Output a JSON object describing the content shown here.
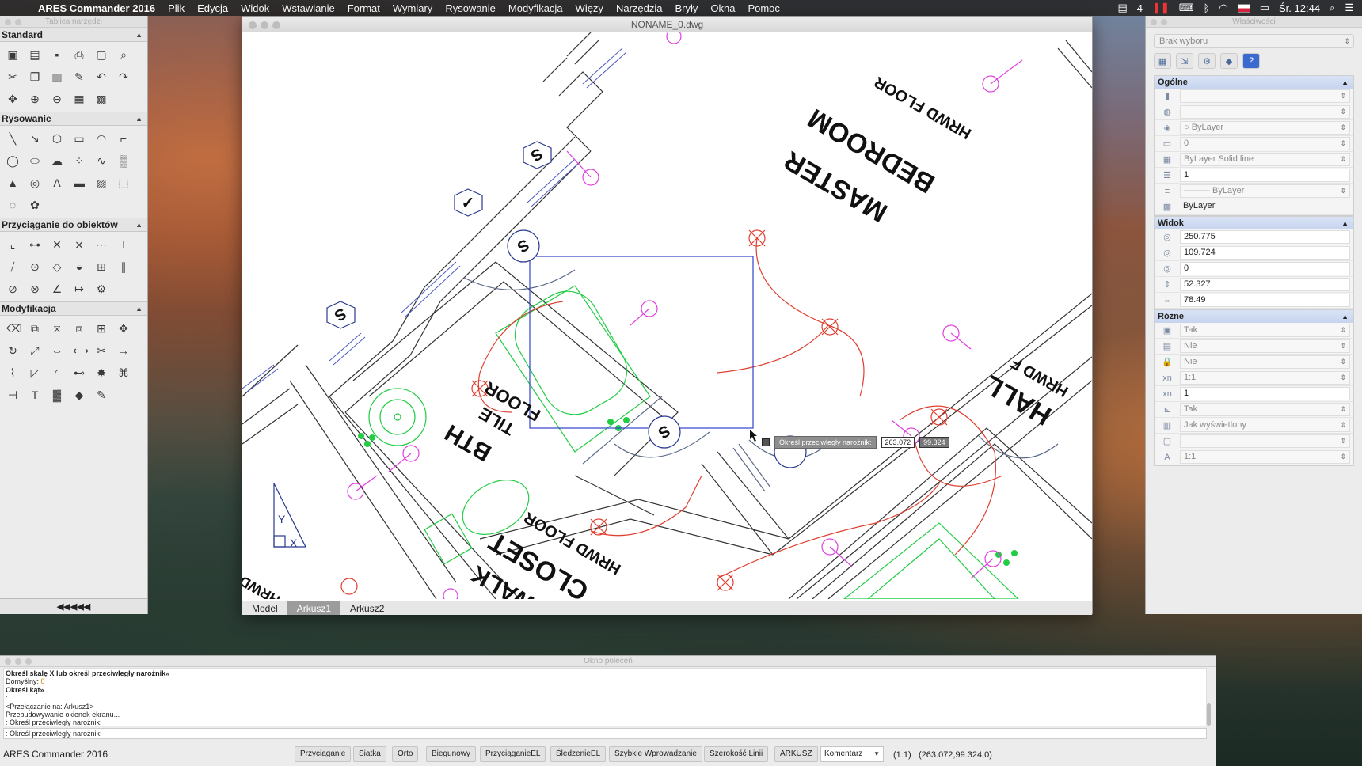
{
  "menubar": {
    "app_name": "ARES Commander 2016",
    "items": [
      "Plik",
      "Edycja",
      "Widok",
      "Wstawianie",
      "Format",
      "Wymiary",
      "Rysowanie",
      "Modyfikacja",
      "Więzy",
      "Narzędzia",
      "Bryły",
      "Okna",
      "Pomoc"
    ],
    "status_count": "4",
    "clock": "Śr. 12:44"
  },
  "palette": {
    "title": "Tablica narzędzi",
    "sections": [
      {
        "label": "Standard",
        "tools": [
          "new-icon",
          "open-icon",
          "save-icon",
          "print-icon",
          "preview-icon",
          "zoom-find-icon",
          "cut-icon",
          "copy-icon",
          "paste-icon",
          "brush-icon",
          "undo-icon",
          "redo-icon",
          "pan-icon",
          "zoom-window-icon",
          "zoom-realtime-icon",
          "properties-icon",
          "calc-icon"
        ]
      },
      {
        "label": "Rysowanie",
        "tools": [
          "line-icon",
          "ray-icon",
          "polygon-icon",
          "rectangle-icon",
          "arc-icon",
          "polyline-icon",
          "circle-icon",
          "ellipse-icon",
          "cloud-icon",
          "points-icon",
          "spline-icon",
          "hatch-icon",
          "block-icon",
          "region-icon",
          "text-icon",
          "mtext-icon",
          "image-icon",
          "boundary-icon",
          "donut-icon",
          "revcloud-icon"
        ]
      },
      {
        "label": "Przyciąganie do obiektów",
        "tools": [
          "snap-endpoint-icon",
          "snap-midpoint-icon",
          "snap-intersection-icon",
          "snap-apparent-icon",
          "snap-extension-icon",
          "snap-perpendicular-icon",
          "snap-nearest-icon",
          "snap-center-icon",
          "snap-quadrant-icon",
          "snap-tangent-icon",
          "snap-insert-icon",
          "snap-parallel-icon",
          "snap-none-icon",
          "snap-node-icon",
          "snap-angle-icon",
          "snap-from-icon",
          "snap-settings-icon"
        ]
      },
      {
        "label": "Modyfikacja",
        "tools": [
          "erase-icon",
          "copy-obj-icon",
          "mirror-icon",
          "offset-icon",
          "array-icon",
          "move-icon",
          "rotate-icon",
          "scale-icon",
          "stretch-icon",
          "lengthen-icon",
          "trim-icon",
          "extend-icon",
          "break-icon",
          "chamfer-icon",
          "fillet-icon",
          "join-icon",
          "explode-icon",
          "edit-polyline-icon",
          "align-icon",
          "edit-text-icon",
          "edit-hatch-icon",
          "edit-block-icon",
          "match-icon"
        ]
      }
    ],
    "bottom_label": "◀◀◀◀◀"
  },
  "drawing": {
    "title": "NONAME_0.dwg",
    "labels": {
      "master_bedroom": "MASTER",
      "master_bedroom2": "BEDROOM",
      "hrwd_floor": "HRWD FLOOR",
      "bath": "BTH",
      "tile_floor": "TILE",
      "tile_floor2": "FLOOR",
      "closet": "CLOSET",
      "walk": "WALK",
      "hall": "HALL",
      "hrwd_partial": "HRWD F",
      "hrwd_left": "HRWD",
      "tag_s1": "S",
      "tag_s2": "S",
      "tag_s3": "S",
      "tag_s4": "S",
      "tag_check": "✓",
      "axis_y": "Y",
      "axis_x": "X"
    },
    "tooltip": {
      "prompt": "Określ przeciwległy narożnik:",
      "value_x": "263.072",
      "value_y": "99.324"
    },
    "tabs": [
      "Model",
      "Arkusz1",
      "Arkusz2"
    ],
    "active_tab": "Arkusz1",
    "colors": {
      "walls": "#333333",
      "fixtures": "#22cc44",
      "electrical": "#e04030",
      "outlets": "#e040e0",
      "selection": "#3344cc",
      "tags": "#2a3a90"
    }
  },
  "properties": {
    "title": "Właściwości",
    "selection": "Brak wyboru",
    "groups": [
      {
        "label": "Ogólne",
        "rows": [
          {
            "icon": "color-icon",
            "value": "",
            "style": "gray"
          },
          {
            "icon": "globe-icon",
            "value": "",
            "style": "gray"
          },
          {
            "icon": "layer-icon",
            "value": "ByLayer",
            "style": "gray",
            "prefix": "○ "
          },
          {
            "icon": "layer-folder-icon",
            "value": "0",
            "style": "gray"
          },
          {
            "icon": "linetype-icon",
            "value": "ByLayer    Solid line",
            "style": "gray"
          },
          {
            "icon": "scale-icon",
            "value": "1",
            "style": "white"
          },
          {
            "icon": "lineweight-icon",
            "value": "——— ByLayer",
            "style": "gray"
          },
          {
            "icon": "transparency-icon",
            "value": "ByLayer",
            "style": "plain"
          }
        ]
      },
      {
        "label": "Widok",
        "rows": [
          {
            "icon": "center-x-icon",
            "value": "250.775",
            "style": "white"
          },
          {
            "icon": "center-y-icon",
            "value": "109.724",
            "style": "white"
          },
          {
            "icon": "center-z-icon",
            "value": "0",
            "style": "white"
          },
          {
            "icon": "height-icon",
            "value": "52.327",
            "style": "white"
          },
          {
            "icon": "width-icon",
            "value": "78.49",
            "style": "white"
          }
        ]
      },
      {
        "label": "Różne",
        "rows": [
          {
            "icon": "on-icon",
            "value": "Tak",
            "style": "gray"
          },
          {
            "icon": "clip-icon",
            "value": "Nie",
            "style": "gray"
          },
          {
            "icon": "lock-icon",
            "value": "Nie",
            "style": "gray"
          },
          {
            "icon": "std-scale-icon",
            "value": "1:1",
            "style": "gray"
          },
          {
            "icon": "custom-scale-icon",
            "value": "1",
            "style": "white"
          },
          {
            "icon": "ucs-icon",
            "value": "Tak",
            "style": "gray"
          },
          {
            "icon": "shade-icon",
            "value": "Jak wyświetlony",
            "style": "gray"
          },
          {
            "icon": "visual-style-icon",
            "value": "",
            "style": "gray"
          },
          {
            "icon": "annotation-icon",
            "value": "1:1",
            "style": "gray"
          }
        ]
      }
    ]
  },
  "command": {
    "title": "Okno poleceń",
    "log": [
      {
        "text": "Określ skalę X lub określ przeciwległy narożnik»",
        "bold": true
      },
      {
        "text": "Domyślny: ",
        "suffix": "0"
      },
      {
        "text": "Określ kąt»",
        "bold": true
      },
      {
        "text": ":"
      },
      {
        "text": "<Przełączanie na: Arkusz1>"
      },
      {
        "text": "Przebudowywanie okienek ekranu..."
      },
      {
        "text": ": Określ przeciwległy narożnik:"
      }
    ],
    "input": ": Określ przeciwległy narożnik:"
  },
  "statusbar": {
    "app_name": "ARES Commander 2016",
    "buttons": [
      "Przyciąganie",
      "Siatka",
      "Orto",
      "Biegunowy",
      "PrzyciąganieEL",
      "ŚledzenieEL",
      "Szybkie Wprowadzanie",
      "Szerokość Linii",
      "ARKUSZ"
    ],
    "dropdown": "Komentarz",
    "scale": "(1:1)",
    "coords": "(263.072,99.324,0)"
  }
}
